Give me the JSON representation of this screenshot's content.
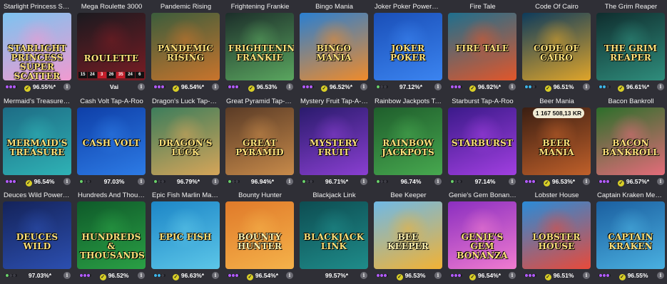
{
  "colors": {
    "background": "#2f2f36",
    "check": "#d9cf27",
    "info": "#6b6b73"
  },
  "games": [
    {
      "title": "Starlight Princess Super ...",
      "rtp": "96.55%*",
      "check": true,
      "dots": [
        "#b45cff",
        "#b45cff",
        "#b45cff"
      ],
      "logo": "Starlight Princess Super Scatter",
      "bg": [
        "#7cc3f0",
        "#f19ad0"
      ],
      "icon": "starlight-princess-thumbnail"
    },
    {
      "title": "Mega Roulette 3000",
      "rtp": "Vai",
      "check": false,
      "dots": [],
      "logo": "Roulette",
      "bg": [
        "#1a1a1f",
        "#7a1c24"
      ],
      "icon": "mega-roulette-thumbnail",
      "numbers": [
        "15",
        "24",
        "3",
        "26",
        "35",
        "24",
        "6"
      ]
    },
    {
      "title": "Pandemic Rising",
      "rtp": "96.54%*",
      "check": true,
      "dots": [
        "#b45cff",
        "#b45cff",
        "#b45cff"
      ],
      "logo": "Pandemic Rising",
      "bg": [
        "#3b5d3c",
        "#c9742c"
      ],
      "icon": "pandemic-rising-thumbnail"
    },
    {
      "title": "Frightening Frankie",
      "rtp": "96.53%",
      "check": true,
      "dots": [
        "#b45cff",
        "#b45cff",
        "#b45cff"
      ],
      "logo": "Frightening Frankie",
      "bg": [
        "#1c2e2a",
        "#5aa65f"
      ],
      "icon": "frightening-frankie-thumbnail"
    },
    {
      "title": "Bingo Mania",
      "rtp": "96.52%*",
      "check": true,
      "dots": [
        "#b45cff",
        "#b45cff",
        "#b45cff"
      ],
      "logo": "Bingo Mania",
      "bg": [
        "#2a7fd1",
        "#f08b2a"
      ],
      "icon": "bingo-mania-thumbnail"
    },
    {
      "title": "Joker Poker Powerpoker",
      "rtp": "97.12%*",
      "check": false,
      "dots": [
        "#6ad16a",
        "#3c3c44",
        "#3c3c44"
      ],
      "logo": "Joker Poker",
      "bg": [
        "#1a4fb8",
        "#3b84f0"
      ],
      "icon": "joker-poker-thumbnail"
    },
    {
      "title": "Fire Tale",
      "rtp": "96.92%*",
      "check": true,
      "dots": [
        "#b45cff",
        "#b45cff",
        "#b45cff"
      ],
      "logo": "Fire Tale",
      "bg": [
        "#1e6f8e",
        "#e2562a"
      ],
      "icon": "fire-tale-thumbnail"
    },
    {
      "title": "Code Of Cairo",
      "rtp": "96.51%",
      "check": true,
      "dots": [
        "#3fb6e8",
        "#3fb6e8",
        "#3c3c44"
      ],
      "logo": "Code of Cairo",
      "bg": [
        "#0d3b5c",
        "#e0a52a"
      ],
      "icon": "code-of-cairo-thumbnail"
    },
    {
      "title": "The Grim Reaper",
      "rtp": "96.61%*",
      "check": true,
      "dots": [
        "#3fb6e8",
        "#3fb6e8",
        "#3c3c44"
      ],
      "logo": "The Grim Reaper",
      "bg": [
        "#0f2d2e",
        "#2f8d7c"
      ],
      "icon": "grim-reaper-thumbnail"
    },
    {
      "title": "Mermaid's Treasure Trove",
      "rtp": "96.54%",
      "check": true,
      "dots": [
        "#b45cff",
        "#b45cff",
        "#b45cff"
      ],
      "logo": "Mermaid's Treasure",
      "bg": [
        "#1d6c85",
        "#2fb2b5"
      ],
      "icon": "mermaids-treasure-thumbnail"
    },
    {
      "title": "Cash Volt Tap-A-Roo",
      "rtp": "97.03%",
      "check": false,
      "dots": [
        "#6ad16a",
        "#3c3c44",
        "#3c3c44"
      ],
      "logo": "Cash Volt",
      "bg": [
        "#0e3fa8",
        "#2d7be5"
      ],
      "icon": "cash-volt-thumbnail"
    },
    {
      "title": "Dragon's Luck Tap-A-Roo",
      "rtp": "96.79%*",
      "check": false,
      "dots": [
        "#6ad16a",
        "#3c3c44",
        "#3c3c44"
      ],
      "logo": "Dragon's Luck",
      "bg": [
        "#3c7d5b",
        "#d6a559"
      ],
      "icon": "dragons-luck-thumbnail"
    },
    {
      "title": "Great Pyramid Tap-A-Roo",
      "rtp": "96.94%*",
      "check": false,
      "dots": [
        "#6ad16a",
        "#3c3c44",
        "#3c3c44"
      ],
      "logo": "Great Pyramid",
      "bg": [
        "#5a3b26",
        "#c78a4a"
      ],
      "icon": "great-pyramid-thumbnail"
    },
    {
      "title": "Mystery Fruit Tap-A-Roo",
      "rtp": "96.71%*",
      "check": false,
      "dots": [
        "#6ad16a",
        "#3c3c44",
        "#3c3c44"
      ],
      "logo": "Mystery Fruit",
      "bg": [
        "#2a1b6d",
        "#8a3fd1"
      ],
      "icon": "mystery-fruit-thumbnail"
    },
    {
      "title": "Rainbow Jackpots Tap-A...",
      "rtp": "96.74%",
      "check": false,
      "dots": [
        "#6ad16a",
        "#3c3c44",
        "#3c3c44"
      ],
      "logo": "Rainbow Jackpots",
      "bg": [
        "#1f5e2c",
        "#47a84f"
      ],
      "icon": "rainbow-jackpots-thumbnail"
    },
    {
      "title": "Starburst Tap-A-Roo",
      "rtp": "97.14%",
      "check": false,
      "dots": [
        "#6ad16a",
        "#3c3c44",
        "#3c3c44"
      ],
      "logo": "Starburst",
      "bg": [
        "#3b1a8a",
        "#a13fe0"
      ],
      "icon": "starburst-thumbnail"
    },
    {
      "title": "Beer Mania",
      "rtp": "96.53%*",
      "check": true,
      "dots": [
        "#b45cff",
        "#b45cff",
        "#b45cff"
      ],
      "logo": "Beer Mania",
      "bg": [
        "#3a1e12",
        "#c0602a"
      ],
      "icon": "beer-mania-thumbnail",
      "jackpot": "1 167 508,13 KR"
    },
    {
      "title": "Bacon Bankroll",
      "rtp": "96.57%*",
      "check": true,
      "dots": [
        "#b45cff",
        "#b45cff",
        "#b45cff"
      ],
      "logo": "Bacon Bankroll",
      "bg": [
        "#2c6e2a",
        "#e46c7a"
      ],
      "icon": "bacon-bankroll-thumbnail"
    },
    {
      "title": "Deuces Wild Powerpoker",
      "rtp": "97.03%*",
      "check": false,
      "dots": [
        "#6ad16a",
        "#3c3c44",
        "#3c3c44"
      ],
      "logo": "Deuces Wild",
      "bg": [
        "#14235a",
        "#2c4fb0"
      ],
      "icon": "deuces-wild-thumbnail"
    },
    {
      "title": "Hundreds And Thousands",
      "rtp": "96.52%",
      "check": true,
      "dots": [
        "#b45cff",
        "#b45cff",
        "#b45cff"
      ],
      "logo": "Hundreds & Thousands",
      "bg": [
        "#0f5a2a",
        "#2aa045"
      ],
      "icon": "hundreds-thousands-thumbnail"
    },
    {
      "title": "Epic Fish Marlin Madness",
      "rtp": "96.63%*",
      "check": true,
      "dots": [
        "#3fb6e8",
        "#3fb6e8",
        "#3c3c44"
      ],
      "logo": "Epic Fish",
      "bg": [
        "#1d86c7",
        "#5cc6e8"
      ],
      "icon": "epic-fish-thumbnail"
    },
    {
      "title": "Bounty Hunter",
      "rtp": "96.54%*",
      "check": true,
      "dots": [
        "#b45cff",
        "#b45cff",
        "#b45cff"
      ],
      "logo": "Bounty Hunter",
      "bg": [
        "#e07a2a",
        "#f5b24a"
      ],
      "icon": "bounty-hunter-thumbnail"
    },
    {
      "title": "Blackjack Link",
      "rtp": "99.57%*",
      "check": false,
      "dots": [],
      "logo": "Blackjack Link",
      "bg": [
        "#0d4d52",
        "#1f8c8a"
      ],
      "icon": "blackjack-link-thumbnail"
    },
    {
      "title": "Bee Keeper",
      "rtp": "96.53%",
      "check": true,
      "dots": [
        "#b45cff",
        "#b45cff",
        "#b45cff"
      ],
      "logo": "Bee Keeper",
      "bg": [
        "#6fb9e6",
        "#f2b234"
      ],
      "icon": "bee-keeper-thumbnail"
    },
    {
      "title": "Genie's Gem Bonanza",
      "rtp": "96.54%*",
      "check": true,
      "dots": [
        "#b45cff",
        "#b45cff",
        "#b45cff"
      ],
      "logo": "Genie's Gem Bonanza",
      "bg": [
        "#8b2fc0",
        "#f07bd0"
      ],
      "icon": "genies-gem-thumbnail"
    },
    {
      "title": "Lobster House",
      "rtp": "96.51%",
      "check": true,
      "dots": [
        "#b45cff",
        "#b45cff",
        "#b45cff"
      ],
      "logo": "Lobster House",
      "bg": [
        "#2a8bd8",
        "#e84a3a"
      ],
      "icon": "lobster-house-thumbnail"
    },
    {
      "title": "Captain Kraken Megaways",
      "rtp": "96.55%",
      "check": true,
      "dots": [
        "#b45cff",
        "#b45cff",
        "#b45cff"
      ],
      "logo": "Captain Kraken",
      "bg": [
        "#1b5fa0",
        "#4ab0e0"
      ],
      "icon": "captain-kraken-thumbnail"
    }
  ]
}
